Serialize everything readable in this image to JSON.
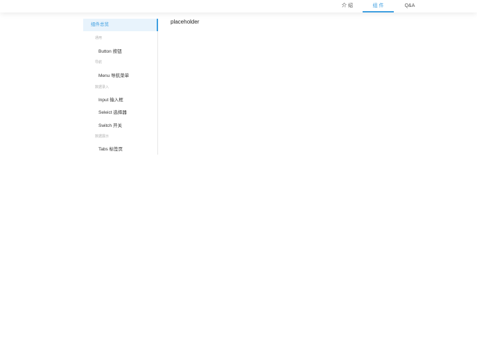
{
  "header": {
    "nav": [
      {
        "label": "介 绍"
      },
      {
        "label": "组 件"
      },
      {
        "label": "Q&A"
      }
    ]
  },
  "sidebar": {
    "overview": "组件总览",
    "groups": [
      {
        "title": "通用",
        "items": [
          "Button 按钮"
        ]
      },
      {
        "title": "导航",
        "items": [
          "Menu 导航菜单"
        ]
      },
      {
        "title": "数据录入",
        "items": [
          "Input 输入框",
          "Seleict 选择器",
          "Switch 开关"
        ]
      },
      {
        "title": "数据展示",
        "items": [
          "Tabs 标签页"
        ]
      }
    ]
  },
  "main": {
    "title": "placeholder"
  },
  "colors": {
    "accent": "#3d9ee0",
    "active_bg": "#e8f3fc"
  }
}
